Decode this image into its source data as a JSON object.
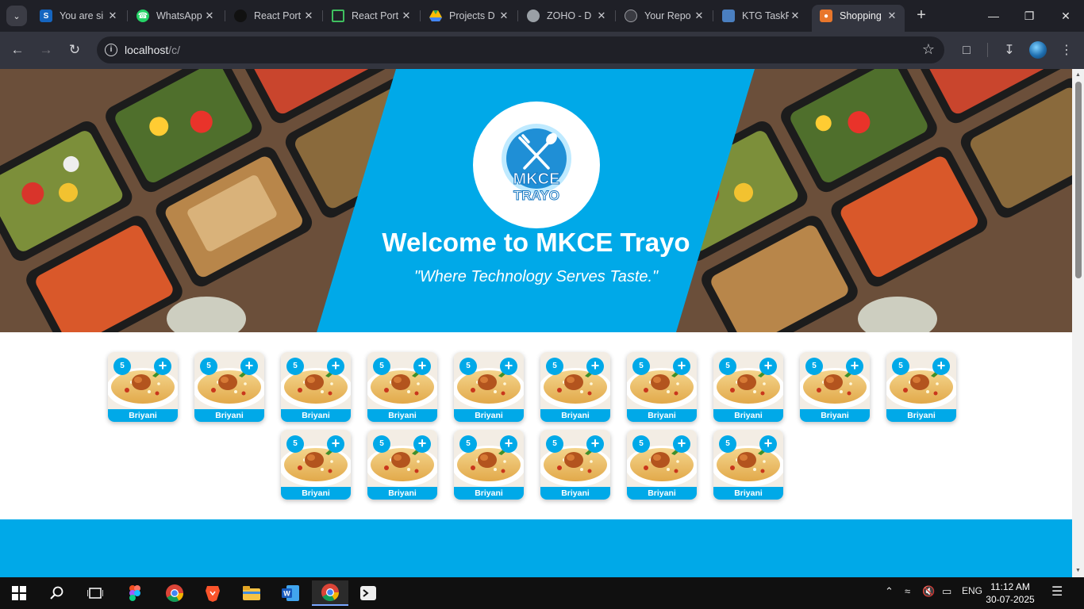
{
  "browser": {
    "tabs": [
      {
        "title": "You are si",
        "icon": "s-icon",
        "active": false
      },
      {
        "title": "WhatsApp",
        "icon": "whatsapp-icon",
        "active": false
      },
      {
        "title": "React Port",
        "icon": "github-dark-icon",
        "active": false
      },
      {
        "title": "React Port",
        "icon": "monitor-icon",
        "active": false
      },
      {
        "title": "Projects D",
        "icon": "google-drive-icon",
        "active": false
      },
      {
        "title": "ZOHO - D",
        "icon": "globe-icon",
        "active": false
      },
      {
        "title": "Your Repo",
        "icon": "github-icon",
        "active": false
      },
      {
        "title": "KTG TaskF",
        "icon": "ktg-icon",
        "active": false
      },
      {
        "title": "Shopping",
        "icon": "shopping-icon",
        "active": true
      }
    ],
    "url_host": "localhost",
    "url_path": "/c/"
  },
  "hero": {
    "logo_line1": "MKCE",
    "logo_line2": "TRAYO",
    "title": "Welcome to MKCE Trayo",
    "tagline": "\"Where Technology Serves Taste.\""
  },
  "items": [
    {
      "name": "Briyani",
      "count": "5"
    },
    {
      "name": "Briyani",
      "count": "5"
    },
    {
      "name": "Briyani",
      "count": "5"
    },
    {
      "name": "Briyani",
      "count": "5"
    },
    {
      "name": "Briyani",
      "count": "5"
    },
    {
      "name": "Briyani",
      "count": "5"
    },
    {
      "name": "Briyani",
      "count": "5"
    },
    {
      "name": "Briyani",
      "count": "5"
    },
    {
      "name": "Briyani",
      "count": "5"
    },
    {
      "name": "Briyani",
      "count": "5"
    },
    {
      "name": "Briyani",
      "count": "5"
    },
    {
      "name": "Briyani",
      "count": "5"
    },
    {
      "name": "Briyani",
      "count": "5"
    },
    {
      "name": "Briyani",
      "count": "5"
    },
    {
      "name": "Briyani",
      "count": "5"
    },
    {
      "name": "Briyani",
      "count": "5"
    }
  ],
  "add_symbol": "+",
  "colors": {
    "accent": "#00a9e8",
    "chrome_dark": "#1f2027",
    "chrome_toolbar": "#33353f"
  },
  "taskbar": {
    "apps": [
      "windows-start-icon",
      "search-icon",
      "task-view-icon",
      "figma-icon",
      "chrome-icon",
      "brave-icon",
      "file-explorer-icon",
      "word-icon",
      "chrome-icon",
      "terminal-app-icon"
    ],
    "language": "ENG",
    "time": "11:12 AM",
    "date": "30-07-2025"
  }
}
